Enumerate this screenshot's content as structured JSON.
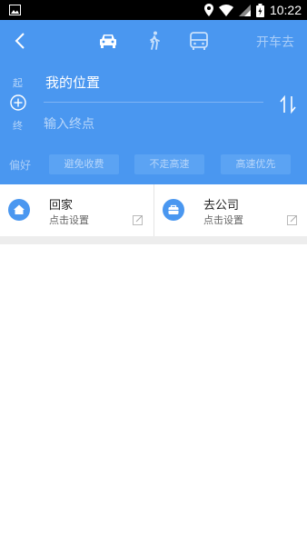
{
  "status_bar": {
    "time": "10:22"
  },
  "nav": {
    "modes": [
      "car-icon",
      "walk-icon",
      "bus-icon"
    ],
    "go_label": "开车去"
  },
  "route": {
    "start_label": "起",
    "end_label": "终",
    "start_value": "我的位置",
    "end_placeholder": "输入终点"
  },
  "preferences": {
    "label": "偏好",
    "options": [
      "避免收费",
      "不走高速",
      "高速优先"
    ]
  },
  "shortcuts": [
    {
      "title": "回家",
      "subtitle": "点击设置",
      "icon": "home-icon"
    },
    {
      "title": "去公司",
      "subtitle": "点击设置",
      "icon": "briefcase-icon"
    }
  ],
  "colors": {
    "header": "#4a97f0",
    "accent": "#4a97f0"
  }
}
